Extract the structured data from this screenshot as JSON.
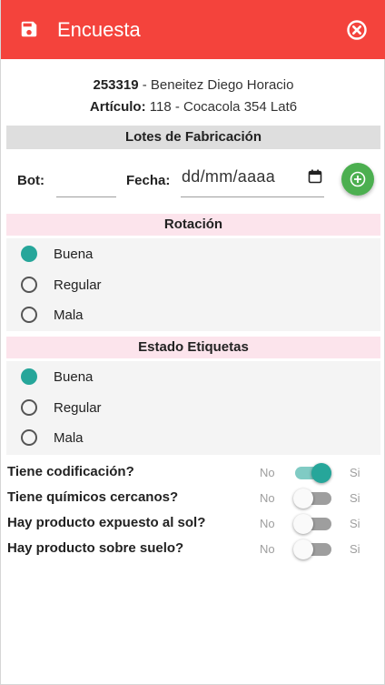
{
  "header": {
    "title": "Encuesta",
    "save_icon": "save-icon",
    "close_icon": "close-circle-icon",
    "color": "#f4433c"
  },
  "cliente": {
    "codigo": "253319",
    "nombre": " - Beneitez Diego Horacio"
  },
  "articulo": {
    "label": "Artículo:",
    "valor": " 118 - Cocacola 354 Lat6"
  },
  "lotes": {
    "title": "Lotes de Fabricación",
    "bot_label": "Bot:",
    "bot_value": "",
    "fecha_label": "Fecha:",
    "fecha_placeholder": "dd/mm/aaaa",
    "add_icon": "add-circle-icon"
  },
  "rotacion": {
    "title": "Rotación",
    "options": [
      {
        "label": "Buena",
        "selected": true
      },
      {
        "label": "Regular",
        "selected": false
      },
      {
        "label": "Mala",
        "selected": false
      }
    ]
  },
  "etiquetas": {
    "title": "Estado Etiquetas",
    "options": [
      {
        "label": "Buena",
        "selected": true
      },
      {
        "label": "Regular",
        "selected": false
      },
      {
        "label": "Mala",
        "selected": false
      }
    ]
  },
  "preguntas": [
    {
      "texto": "Tiene codificación?",
      "no": "No",
      "si": "Si",
      "valor": true
    },
    {
      "texto": "Tiene químicos cercanos?",
      "no": "No",
      "si": "Si",
      "valor": false
    },
    {
      "texto": "Hay producto expuesto al sol?",
      "no": "No",
      "si": "Si",
      "valor": false
    },
    {
      "texto": "Hay producto sobre suelo?",
      "no": "No",
      "si": "Si",
      "valor": false
    }
  ],
  "colors": {
    "accent": "#26a69a",
    "add_button": "#4caf50",
    "section_pink": "#fce4ec",
    "section_grey": "#dedede"
  }
}
